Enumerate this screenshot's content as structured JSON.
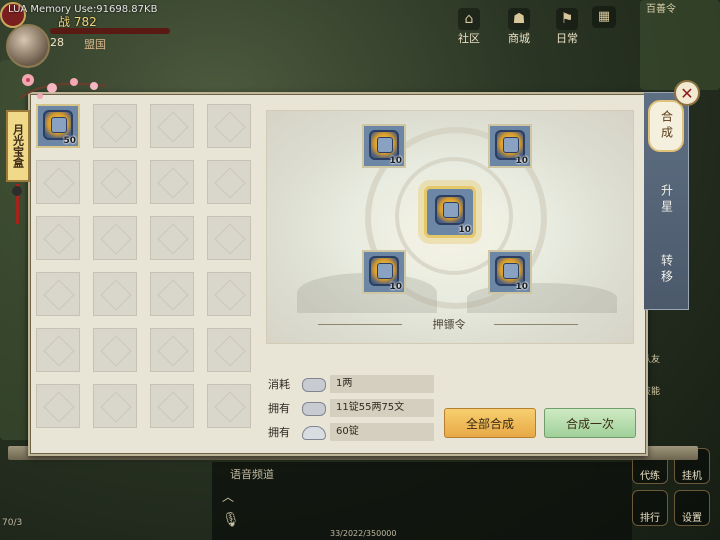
{
  "hud": {
    "debug": "LUA Memory Use:91698.87KB",
    "power": "战 782",
    "level": "28",
    "faction": "盟国"
  },
  "topnav": [
    {
      "label": "社区",
      "icon": "community-icon"
    },
    {
      "label": "商城",
      "icon": "shop-icon"
    },
    {
      "label": "日常",
      "icon": "daily-icon"
    }
  ],
  "rail": {
    "top": "百善令",
    "b1": "代练",
    "b2": "挂机",
    "b3": "排行",
    "b4": "设置",
    "side1": "队友",
    "side2": "技能"
  },
  "chat": {
    "tab": "语音频道"
  },
  "exp_text": "33/2022/350000",
  "left_small": "70/3",
  "ribbon": "月光宝盒",
  "tabs": [
    {
      "label": "合成",
      "active": true
    },
    {
      "label": "升星",
      "active": false
    },
    {
      "label": "转移",
      "active": false
    }
  ],
  "inventory": {
    "slots": 24,
    "items": [
      {
        "slot": 0,
        "name": "押镖令",
        "qty": "50"
      }
    ]
  },
  "synthesis": {
    "materials": [
      "10",
      "10",
      "10",
      "10"
    ],
    "result_qty": "10",
    "result_name": "押镖令"
  },
  "costs": {
    "consume_label": "消耗",
    "consume_value": "1两",
    "own_label": "拥有",
    "own_silver_value": "11锭55两75文",
    "own_label_2": "拥有",
    "own_ingot_value": "60锭"
  },
  "buttons": {
    "all": "全部合成",
    "once": "合成一次"
  },
  "colors": {
    "panel": "#e8e4d6",
    "item_bg": "#6c86a6",
    "btn_all": "#f0b95a",
    "btn_once": "#b6dcae",
    "tab_bg": "#556477"
  }
}
